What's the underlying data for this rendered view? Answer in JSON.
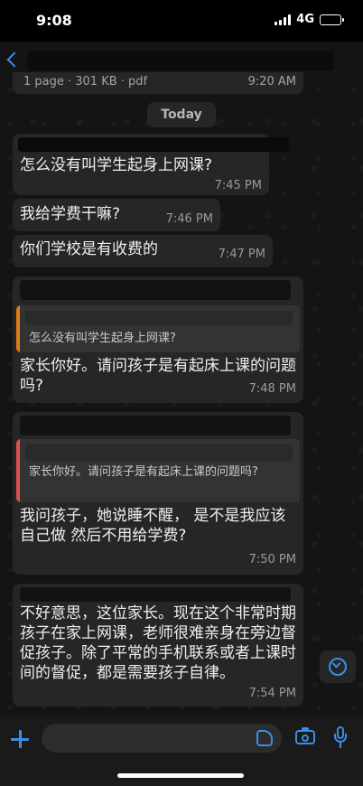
{
  "status": {
    "time": "9:08",
    "network": "4G"
  },
  "file": {
    "meta": "1 page · 301 KB · pdf",
    "time": "9:20 AM"
  },
  "date_divider": "Today",
  "messages": [
    {
      "text": "怎么没有叫学生起身上网课?",
      "time": "7:45 PM"
    },
    {
      "text": "我给学费干嘛?",
      "time": "7:46 PM"
    },
    {
      "text": "你们学校是有收费的",
      "time": "7:47 PM"
    },
    {
      "quote_text": "怎么没有叫学生起身上网课?",
      "text": "家长你好。请问孩子是有起床上课的问题吗?",
      "time": "7:48 PM"
    },
    {
      "quote_text": "家长你好。请问孩子是有起床上课的问题吗?",
      "text": "我问孩子，她说睡不醒， 是不是我应该自己做 然后不用给学费?",
      "time": "7:50 PM"
    },
    {
      "text": "不好意思，这位家长。现在这个非常时期孩子在家上网课，老师很难亲身在旁边督促孩子。除了平常的手机联系或者上课时间的督促，都是需要孩子自律。",
      "time": "7:54 PM"
    }
  ],
  "colors": {
    "accent": "#3a8ee6",
    "bubble": "#262626",
    "quote_bar_orange": "#e07b1a",
    "quote_bar_red": "#d9534f"
  },
  "icons": [
    "back-arrow-icon",
    "plus-icon",
    "sticker-icon",
    "camera-icon",
    "mic-icon",
    "scroll-down-icon"
  ]
}
